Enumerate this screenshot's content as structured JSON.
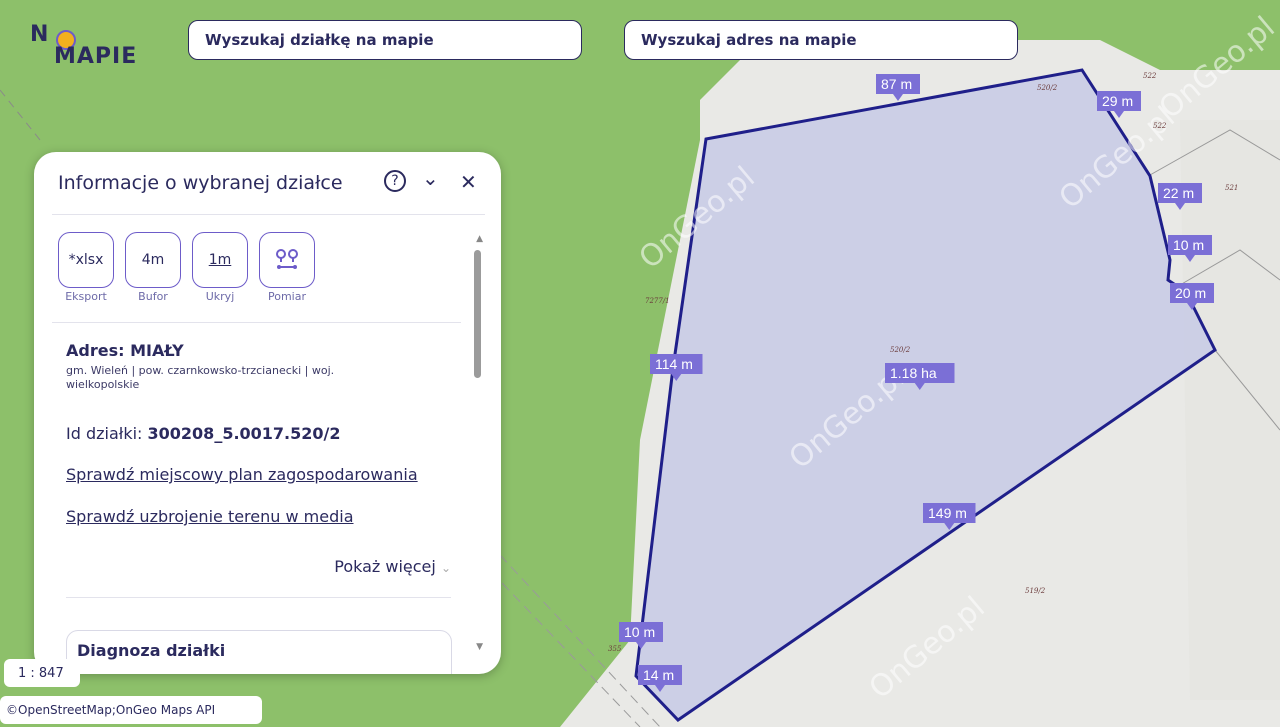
{
  "app": {
    "logo_line1": "N",
    "logo_line2": "MAPIE"
  },
  "search": {
    "parcel": "Wyszukaj działkę na mapie",
    "address": "Wyszukaj adres na mapie"
  },
  "panel": {
    "title": "Informacje o wybranej działce",
    "help_icon": "?",
    "collapse_icon": "⌄",
    "close_icon": "✕",
    "tools": [
      {
        "value": "*xlsx",
        "label": "Eksport"
      },
      {
        "value": "4m",
        "label": "Bufor"
      },
      {
        "value": "1m",
        "label": "Ukryj"
      },
      {
        "value": "",
        "label": "Pomiar"
      }
    ],
    "address": "Adres: MIAŁY",
    "address_detail": "gm. Wieleń | pow. czarnkowsko-trzcianecki | woj. wielkopolskie",
    "id_label": "Id działki:",
    "id_value": "300208_5.0017.520/2",
    "link_plan": "Sprawdź miejscowy plan zagospodarowania",
    "link_media": "Sprawdź uzbrojenie terenu w media",
    "show_more": "Pokaż więcej",
    "diagnosis": "Diagnoza działki"
  },
  "map": {
    "scale": "1 : 847",
    "attribution": "©OpenStreetMap;OnGeo Maps API",
    "watermark": "OnGeo.pl",
    "measurements": [
      "87 m",
      "29 m",
      "22 m",
      "10 m",
      "20 m",
      "114 m",
      "1.18 ha",
      "149 m",
      "10 m",
      "14 m"
    ],
    "parcel_labels": [
      "520/2",
      "522",
      "522",
      "521",
      "7277/1",
      "520/2",
      "519/2",
      "355"
    ],
    "colors": {
      "forest": "#8dc06a",
      "parcel_fill": "#c9cce6",
      "parcel_stroke": "#1f1f8a",
      "label_bg": "#7b6fd6",
      "accent": "#2b2a5e"
    }
  }
}
